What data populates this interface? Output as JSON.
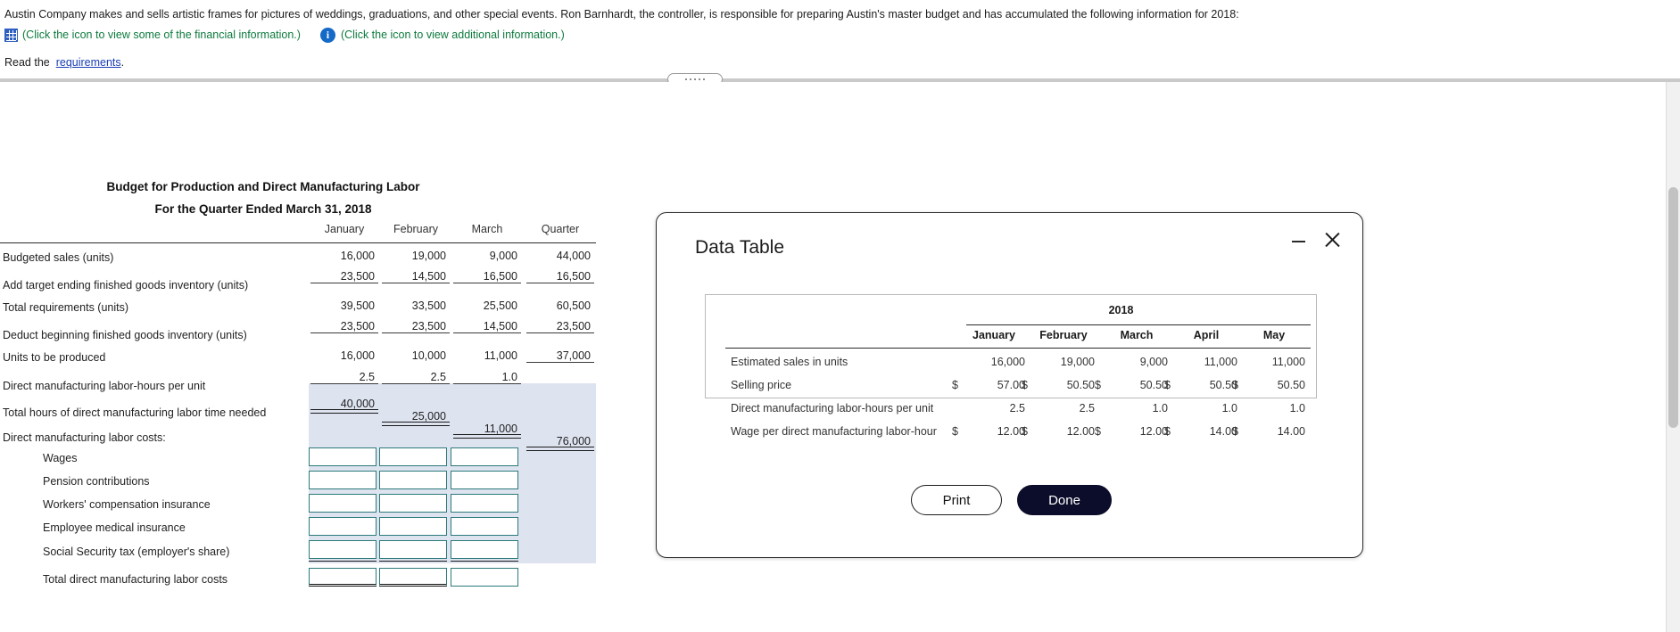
{
  "problem": {
    "statement": "Austin Company makes and sells artistic frames for pictures of weddings, graduations, and other special events. Ron Barnhardt, the controller, is responsible for preparing Austin's master budget and has accumulated the following information for 2018:",
    "financial_link": "(Click the icon to view some of the financial information.)",
    "additional_link": "(Click the icon to view additional information.)",
    "read_prefix": "Read the",
    "requirements_link": "requirements",
    "read_suffix": ".",
    "grid_icon": "grid-icon",
    "info_icon": "info-icon"
  },
  "worksheet": {
    "title_line1": "Budget for Production and Direct Manufacturing Labor",
    "title_line2": "For the Quarter Ended March 31, 2018",
    "columns": [
      "January",
      "February",
      "March",
      "Quarter"
    ],
    "rows": [
      {
        "label": "Budgeted sales (units)",
        "values": [
          "16,000",
          "19,000",
          "9,000",
          "44,000"
        ]
      },
      {
        "label": "Add target ending finished goods inventory (units)",
        "values": [
          "23,500",
          "14,500",
          "16,500",
          "16,500"
        ]
      },
      {
        "label": "Total requirements (units)",
        "values": [
          "39,500",
          "33,500",
          "25,500",
          "60,500"
        ]
      },
      {
        "label": "Deduct beginning finished goods inventory (units)",
        "values": [
          "23,500",
          "23,500",
          "14,500",
          "23,500"
        ]
      },
      {
        "label": "Units to be produced",
        "values": [
          "16,000",
          "10,000",
          "11,000",
          "37,000"
        ]
      },
      {
        "label": "Direct manufacturing labor-hours per unit",
        "values": [
          "2.5",
          "2.5",
          "1.0",
          ""
        ]
      },
      {
        "label": "Total hours of direct manufacturing labor time needed",
        "values": [
          "40,000",
          "25,000",
          "11,000",
          "76,000"
        ]
      }
    ],
    "costs_header": "Direct manufacturing labor costs:",
    "cost_rows": [
      {
        "label": "Wages"
      },
      {
        "label": "Pension contributions"
      },
      {
        "label": "Workers' compensation insurance"
      },
      {
        "label": "Employee medical insurance"
      },
      {
        "label": "Social Security tax (employer's share)"
      },
      {
        "label": "Total direct manufacturing labor costs"
      }
    ]
  },
  "modal": {
    "title": "Data Table",
    "minimize_icon": "minimize-icon",
    "close_icon": "close-icon",
    "year": "2018",
    "columns": [
      "January",
      "February",
      "March",
      "April",
      "May"
    ],
    "rows": [
      {
        "label": "Estimated sales in units",
        "currency": false,
        "values": [
          "16,000",
          "19,000",
          "9,000",
          "11,000",
          "11,000"
        ]
      },
      {
        "label": "Selling price",
        "currency": true,
        "values": [
          "57.00",
          "50.50",
          "50.50",
          "50.50",
          "50.50"
        ]
      },
      {
        "label": "Direct manufacturing labor-hours per unit",
        "currency": false,
        "values": [
          "2.5",
          "2.5",
          "1.0",
          "1.0",
          "1.0"
        ]
      },
      {
        "label": "Wage per direct manufacturing labor-hour",
        "currency": true,
        "values": [
          "12.00",
          "12.00",
          "12.00",
          "14.00",
          "14.00"
        ]
      }
    ],
    "dollar_sign": "$",
    "print_label": "Print",
    "done_label": "Done"
  },
  "colors": {
    "shade": "#dde3ef",
    "link_green": "#0d7a3e",
    "link_blue": "#1a3fb5",
    "input_border": "#2c7a7b",
    "done_bg": "#0c0c2b"
  }
}
